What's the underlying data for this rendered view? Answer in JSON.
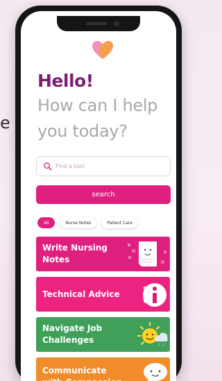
{
  "background": {
    "side_text": "e"
  },
  "app": {
    "greeting": "Hello!",
    "prompt": "How can I help you today?"
  },
  "search": {
    "placeholder": "Find a tool",
    "button_label": "search"
  },
  "filters": [
    {
      "label": "All",
      "active": true
    },
    {
      "label": "Nurse Notes",
      "active": false
    },
    {
      "label": "Patient Care",
      "active": false
    }
  ],
  "tools": [
    {
      "label": "Write Nursing Notes",
      "icon": "notepad-icon",
      "color": "#e0207f"
    },
    {
      "label": "Technical Advice",
      "icon": "info-icon",
      "color": "#ec2380"
    },
    {
      "label": "Navigate Job Challenges",
      "icon": "sun-cloud-icon",
      "color": "#40a05a"
    },
    {
      "label": "Communicate with Compassion",
      "icon": "speech-bubble-icon",
      "color": "#f08c2a"
    }
  ],
  "colors": {
    "brand_pink": "#e0207f",
    "brand_purple": "#7b1f72",
    "muted_text": "#a8a8a8"
  }
}
